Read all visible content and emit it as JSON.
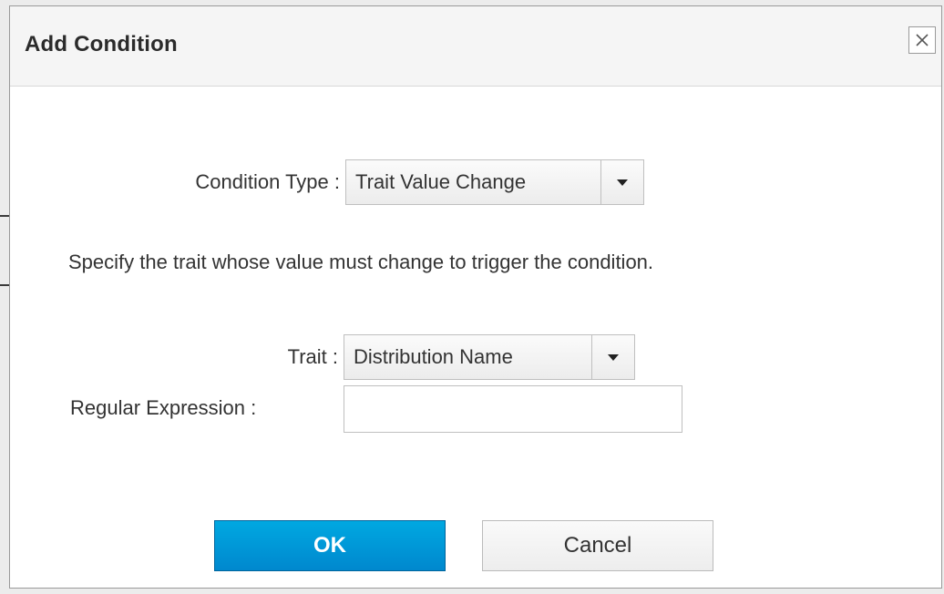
{
  "dialog": {
    "title": "Add Condition",
    "close_icon": "close-icon"
  },
  "condition_type": {
    "label": "Condition Type :",
    "value": "Trait Value Change",
    "caret_icon": "caret-down-icon"
  },
  "description": "Specify the trait whose value must change to trigger the condition.",
  "trait": {
    "label": "Trait :",
    "value": "Distribution Name",
    "caret_icon": "caret-down-icon"
  },
  "regex": {
    "label": "Regular Expression :",
    "value": "",
    "placeholder": ""
  },
  "buttons": {
    "ok": "OK",
    "cancel": "Cancel"
  },
  "colors": {
    "primary": "#0088ce",
    "primary_border": "#00659c"
  }
}
